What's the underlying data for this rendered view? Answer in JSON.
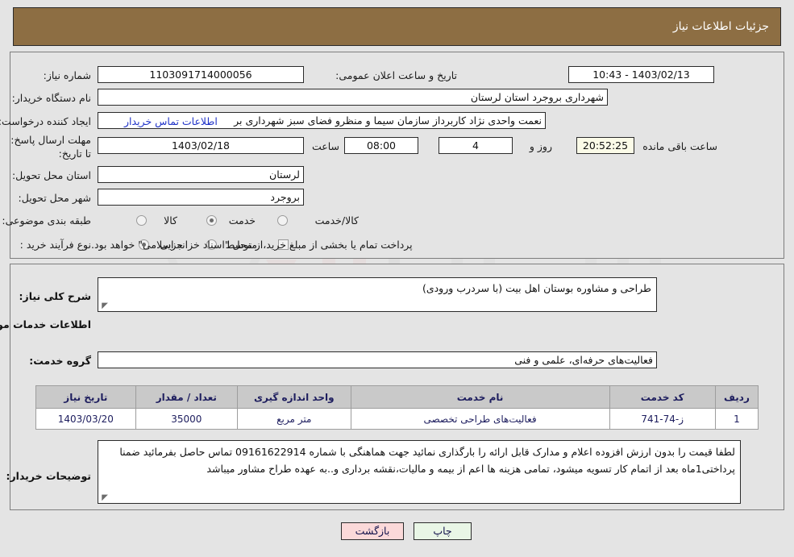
{
  "header": {
    "title": "جزئیات اطلاعات نیاز"
  },
  "form": {
    "need_number_label": "شماره نیاز:",
    "need_number_value": "1103091714000056",
    "public_announce_label": "تاریخ و ساعت اعلان عمومی:",
    "public_announce_value": "1403/02/13 - 10:43",
    "buyer_org_label": "نام دستگاه خریدار:",
    "buyer_org_value": "شهرداری بروجرد استان لرستان",
    "creator_label": "ایجاد کننده درخواست:",
    "creator_value": "نعمت واحدی نژاد کاربرداز سازمان سیما و منظرو فضای سبز شهرداری بر",
    "buyer_contact_link": "اطلاعات تماس خریدار",
    "deadline_label": "مهلت ارسال پاسخ: تا تاریخ:",
    "deadline_date": "1403/02/18",
    "hour_label": "ساعت",
    "deadline_time": "08:00",
    "days_left": "4",
    "days_label": "روز و",
    "time_left": "20:52:25",
    "time_left_label": "ساعت باقی مانده",
    "province_label": "استان محل تحویل:",
    "province_value": "لرستان",
    "city_label": "شهر محل تحویل:",
    "city_value": "بروجرد",
    "category_label": "طبقه بندی موضوعی:",
    "category_options": [
      "کالا",
      "خدمت",
      "کالا/خدمت"
    ],
    "category_selected": "خدمت",
    "process_label": "نوع فرآیند خرید :",
    "process_options": [
      "جزیی",
      "متوسط"
    ],
    "process_selected": "جزیی",
    "treasury_checkbox_text": "پرداخت تمام یا بخشی از مبلغ خرید،از محل \"اسناد خزانه اسلامی\" خواهد بود.",
    "treasury_checked": false
  },
  "detail": {
    "need_desc_label": "شرح کلی نیاز:",
    "need_desc_value": "طراحی و مشاوره بوستان اهل بیت (با سردرب ورودی)",
    "services_heading": "اطلاعات خدمات مورد نیاز",
    "service_group_label": "گروه خدمت:",
    "service_group_value": "فعالیت‌های حرفه‌ای، علمی و فنی",
    "buyer_notes_label": "توضیحات خریدار:",
    "buyer_notes_value": "لطفا قیمت را بدون ارزش افزوده اعلام و مدارک قابل ارائه را بارگذاری نمائید جهت هماهنگی با شماره 09161622914 تماس حاصل بفرمائید ضمنا پرداختی1ماه بعد از اتمام کار تسویه میشود، تمامی هزینه ها اعم از بیمه و مالیات،نقشه برداری و..به عهده طراح مشاور میباشد"
  },
  "table": {
    "headers": [
      "ردیف",
      "کد خدمت",
      "نام خدمت",
      "واحد اندازه گیری",
      "تعداد / مقدار",
      "تاریخ نیاز"
    ],
    "rows": [
      {
        "row_no": "1",
        "service_code": "ز-74-741",
        "service_name": "فعالیت‌های طراحی تخصصی",
        "unit": "متر مربع",
        "quantity": "35000",
        "need_date": "1403/03/20"
      }
    ]
  },
  "buttons": {
    "print": "چاپ",
    "back": "بازگشت"
  },
  "watermark": {
    "text": "AriaTender.net"
  },
  "colors": {
    "header_brown": "#8d6e43",
    "page_bg": "#e4e4e4",
    "link_blue": "#2033c8",
    "table_header_bg": "#c9c9c9",
    "table_text": "#1d1d5e",
    "countdown_bg": "#fbfbe8",
    "print_btn_bg": "#e9f6e6",
    "back_btn_bg": "#fbd9d9"
  }
}
